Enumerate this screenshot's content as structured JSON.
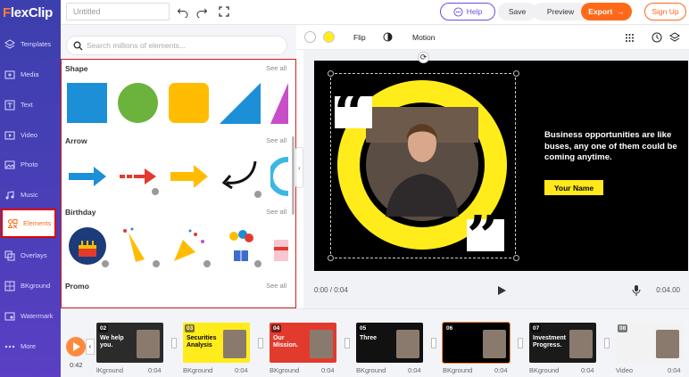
{
  "app": {
    "logo": "FlexClip",
    "logo_first": "F",
    "logo_rest": "lexClip"
  },
  "topbar": {
    "title_placeholder": "Untitled",
    "help_label": "Help",
    "save_label": "Save",
    "preview_label": "Preview",
    "export_label": "Export",
    "signup_label": "Sign Up"
  },
  "sidebar": {
    "items": [
      {
        "label": "Templates",
        "icon": "templates-icon"
      },
      {
        "label": "Media",
        "icon": "media-icon"
      },
      {
        "label": "Text",
        "icon": "text-icon"
      },
      {
        "label": "Video",
        "icon": "video-icon"
      },
      {
        "label": "Photo",
        "icon": "photo-icon"
      },
      {
        "label": "Music",
        "icon": "music-icon"
      },
      {
        "label": "Elements",
        "icon": "elements-icon",
        "active": true
      },
      {
        "label": "Overlays",
        "icon": "overlays-icon"
      },
      {
        "label": "BKground",
        "icon": "background-icon"
      },
      {
        "label": "Watermark",
        "icon": "watermark-icon"
      },
      {
        "label": "More",
        "icon": "more-icon"
      }
    ]
  },
  "elements_panel": {
    "search_placeholder": "Search millions of elements...",
    "sections": [
      {
        "title": "Shape",
        "see_all": "See all"
      },
      {
        "title": "Arrow",
        "see_all": "See all"
      },
      {
        "title": "Birthday",
        "see_all": "See all"
      },
      {
        "title": "Promo",
        "see_all": "See all"
      }
    ]
  },
  "edit_toolbar": {
    "flip_label": "Flip",
    "motion_label": "Motion",
    "colors": [
      "#ffffff",
      "#ffec1a"
    ]
  },
  "canvas": {
    "headline": "Business opportunities are like buses, any one of them could be coming anytime.",
    "name_tag": "Your Name",
    "accent": "#ffec1a",
    "quote_open": "“",
    "quote_close": "”"
  },
  "player": {
    "current": "0:00 / 0:04",
    "total": "0:04.00"
  },
  "timeline": {
    "playhead_time": "0:42",
    "scenes": [
      {
        "num": "02",
        "label": "lKground",
        "duration": "0:04",
        "bg": "#2b2b2b",
        "caption": "We help you."
      },
      {
        "num": "03",
        "label": "BKground",
        "duration": "0:04",
        "bg": "#ffec1a",
        "caption": "Securities Analysis"
      },
      {
        "num": "04",
        "label": "BKground",
        "duration": "0:04",
        "bg": "#e23b2e",
        "caption": "Our Mission."
      },
      {
        "num": "05",
        "label": "BKground",
        "duration": "0:04",
        "bg": "#111111",
        "caption": "Three"
      },
      {
        "num": "06",
        "label": "BKground",
        "duration": "0:04",
        "bg": "#000000",
        "caption": ""
      },
      {
        "num": "07",
        "label": "BKground",
        "duration": "0:04",
        "bg": "#1a1a1a",
        "caption": "Investment Progress."
      },
      {
        "num": "08",
        "label": "Video",
        "duration": "0:04",
        "bg": "#f2f2f2",
        "caption": ""
      }
    ]
  }
}
